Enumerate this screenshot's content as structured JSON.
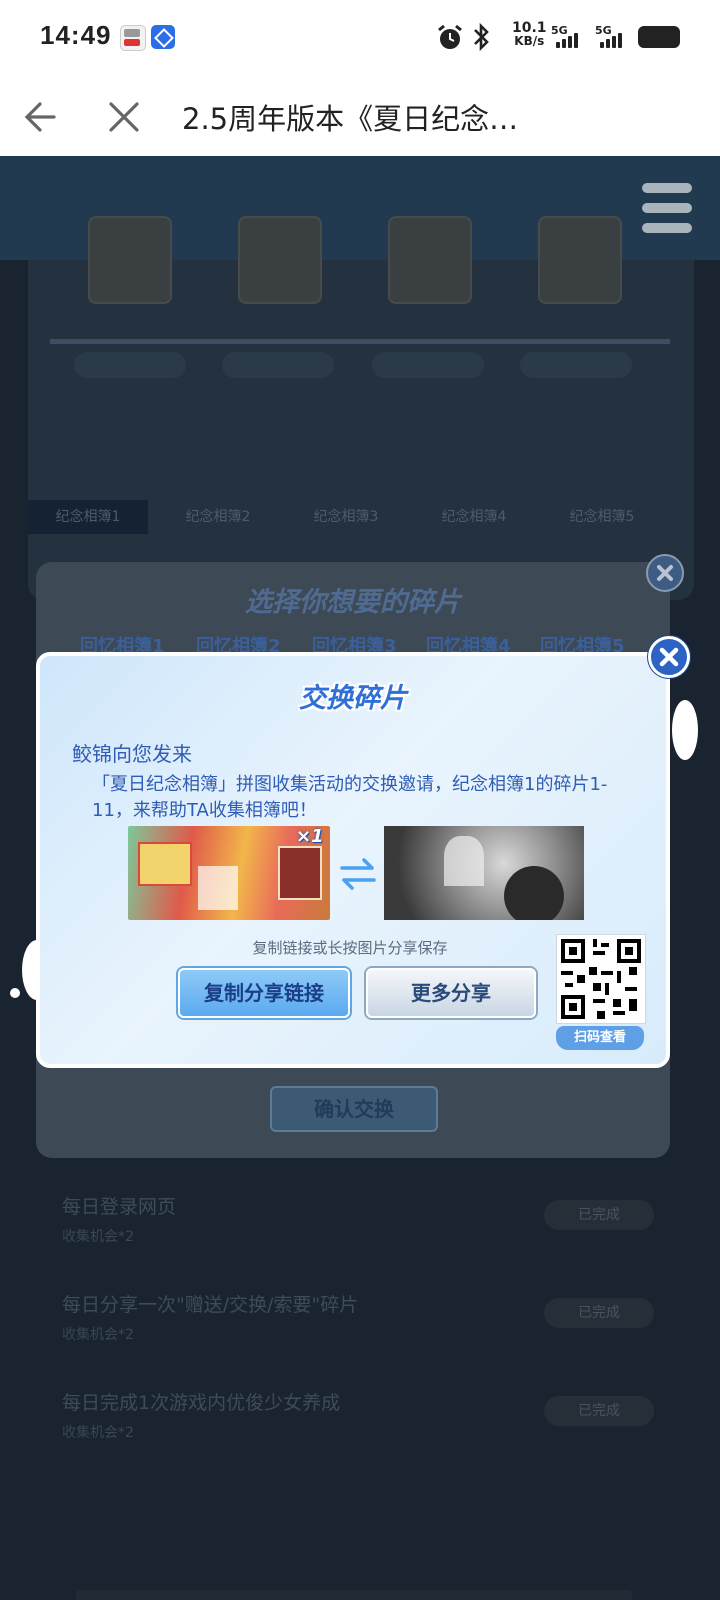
{
  "status_bar": {
    "time": "14:49",
    "net_speed_value": "10.1",
    "net_speed_unit": "KB/s",
    "sim1": "5G",
    "sim2": "5G",
    "icons": [
      "app-icon",
      "app-icon",
      "alarm-icon",
      "bluetooth-icon",
      "signal-icon",
      "battery-icon"
    ]
  },
  "nav": {
    "title": "2.5周年版本《夏日纪念…"
  },
  "background_page": {
    "album_tabs": [
      "纪念相簿1",
      "纪念相簿2",
      "纪念相簿3",
      "纪念相簿4",
      "纪念相簿5"
    ],
    "tasks": [
      {
        "title": "每日登录网页",
        "sub": "收集机会*2",
        "status": "已完成"
      },
      {
        "title": "每日分享一次\"赠送/交换/索要\"碎片",
        "sub": "收集机会*2",
        "status": "已完成"
      },
      {
        "title": "每日完成1次游戏内优俊少女养成",
        "sub": "收集机会*2",
        "status": "已完成"
      }
    ]
  },
  "select_dialog": {
    "title": "选择你想要的碎片",
    "tabs": [
      "回忆相簿1",
      "回忆相簿2",
      "回忆相簿3",
      "回忆相簿4",
      "回忆相簿5"
    ],
    "confirm": "确认交换"
  },
  "exchange_dialog": {
    "title": "交换碎片",
    "sender": "鲛锦向您发来",
    "message": "「夏日纪念相簿」拼图收集活动的交换邀请，纪念相簿1的碎片1-11，来帮助TA收集相簿吧！",
    "item_count": "×1",
    "hint": "复制链接或长按图片分享保存",
    "copy_button": "复制分享链接",
    "more_button": "更多分享",
    "qr_label": "扫码查看"
  },
  "colors": {
    "accent_blue": "#2f6fd8",
    "dim_overlay": "#1a2431"
  }
}
